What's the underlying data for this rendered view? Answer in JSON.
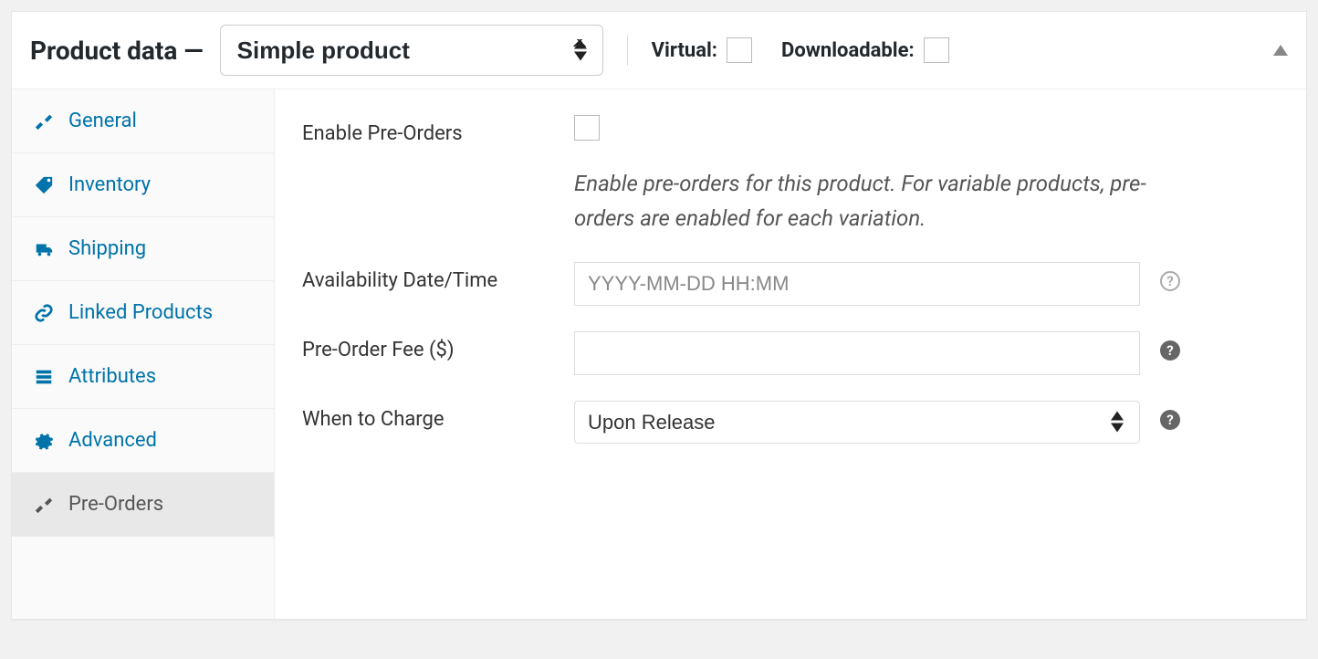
{
  "header": {
    "title": "Product data —",
    "product_type": "Simple product",
    "virtual_label": "Virtual:",
    "downloadable_label": "Downloadable:"
  },
  "tabs": [
    {
      "key": "general",
      "label": "General",
      "icon": "wrench"
    },
    {
      "key": "inventory",
      "label": "Inventory",
      "icon": "tag"
    },
    {
      "key": "shipping",
      "label": "Shipping",
      "icon": "truck"
    },
    {
      "key": "linked",
      "label": "Linked Products",
      "icon": "link"
    },
    {
      "key": "attributes",
      "label": "Attributes",
      "icon": "list"
    },
    {
      "key": "advanced",
      "label": "Advanced",
      "icon": "gear"
    },
    {
      "key": "preorders",
      "label": "Pre-Orders",
      "icon": "wrench",
      "active": true
    }
  ],
  "form": {
    "enable_label": "Enable Pre-Orders",
    "enable_desc": "Enable pre-orders for this product. For variable products, pre-orders are enabled for each variation.",
    "availability_label": "Availability Date/Time",
    "availability_placeholder": "YYYY-MM-DD HH:MM",
    "fee_label": "Pre-Order Fee ($)",
    "charge_label": "When to Charge",
    "charge_value": "Upon Release"
  }
}
